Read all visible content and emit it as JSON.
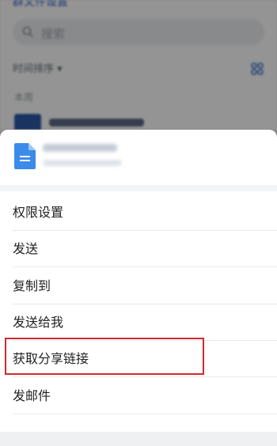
{
  "background": {
    "title": "群文件设置",
    "search_placeholder": "搜索",
    "sort_label": "时间排序 ▾",
    "section_label": "本周"
  },
  "menu": {
    "items": [
      {
        "label": "权限设置"
      },
      {
        "label": "发送"
      },
      {
        "label": "复制到"
      },
      {
        "label": "发送给我"
      },
      {
        "label": "获取分享链接"
      },
      {
        "label": "发邮件"
      }
    ]
  },
  "icons": {
    "search": "search-icon",
    "grid": "grid-view-icon",
    "file": "document-file-icon",
    "folder": "folder-icon"
  },
  "colors": {
    "accent": "#2f63c7",
    "highlight": "#cf2a2e",
    "doc_icon": "#3b8bea"
  }
}
